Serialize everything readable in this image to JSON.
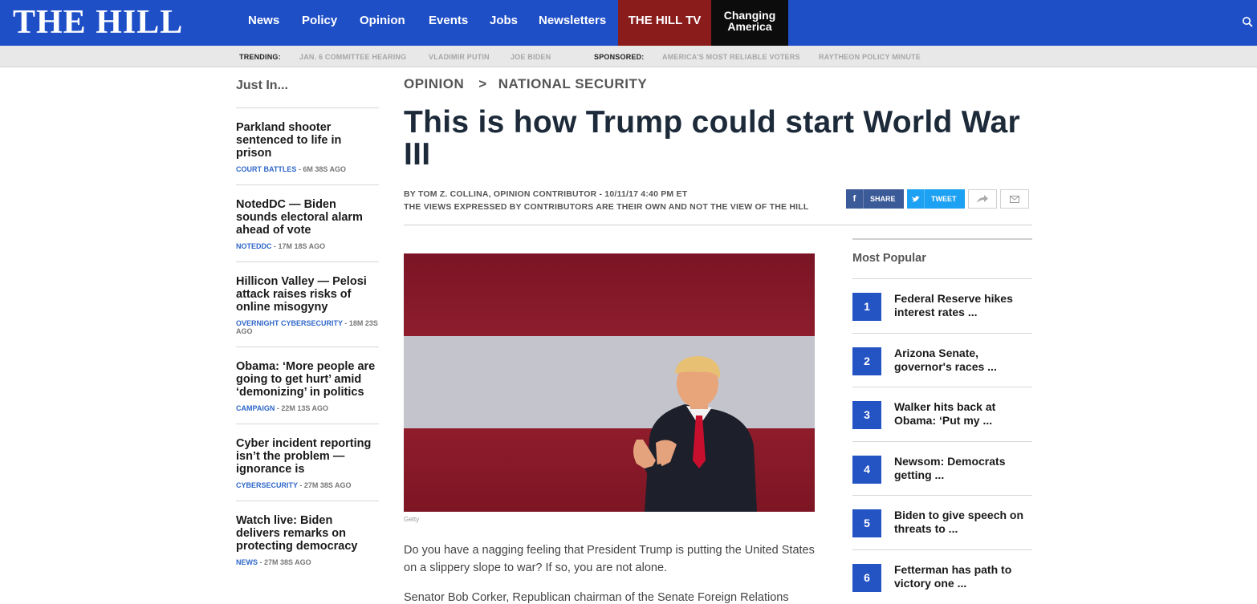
{
  "brand": {
    "logo": "THE HILL"
  },
  "nav": {
    "items": [
      "News",
      "Policy",
      "Opinion",
      "Events",
      "Jobs",
      "Newsletters"
    ],
    "tv": "THE HILL TV",
    "changing": "Changing\nAmerica"
  },
  "trending": {
    "label": "TRENDING:",
    "links": [
      "JAN. 6 COMMITTEE HEARING",
      "VLADIMIR PUTIN",
      "JOE BIDEN"
    ],
    "sponsored_label": "SPONSORED:",
    "sponsored_links": [
      "AMERICA'S MOST RELIABLE VOTERS",
      "RAYTHEON POLICY MINUTE"
    ]
  },
  "just_in": {
    "title": "Just In...",
    "items": [
      {
        "title": "Parkland shooter sentenced to life in prison",
        "category": "COURT BATTLES",
        "time": " - 6M 38S AGO"
      },
      {
        "title": "NotedDC — Biden sounds electoral alarm ahead of vote",
        "category": "NOTEDDC",
        "time": " - 17M 18S AGO"
      },
      {
        "title": "Hillicon Valley — Pelosi attack raises risks of online misogyny",
        "category": "OVERNIGHT CYBERSECURITY",
        "time": " - 18M 23S AGO"
      },
      {
        "title": "Obama: ‘More people are going to get hurt’ amid ‘demonizing’ in politics",
        "category": "CAMPAIGN",
        "time": " - 22M 13S AGO"
      },
      {
        "title": "Cyber incident reporting isn’t the problem — ignorance is",
        "category": "CYBERSECURITY",
        "time": " - 27M 38S AGO"
      },
      {
        "title": "Watch live: Biden delivers remarks on protecting democracy",
        "category": "NEWS",
        "time": " - 27M 38S AGO"
      }
    ]
  },
  "article": {
    "breadcrumb": [
      "OPINION",
      ">",
      "NATIONAL SECURITY"
    ],
    "headline": "This is how Trump could start World War III",
    "byline": "BY TOM Z. COLLINA, OPINION CONTRIBUTOR - 10/11/17 4:40 PM ET",
    "disclaimer": "THE VIEWS EXPRESSED BY CONTRIBUTORS ARE THEIR OWN AND NOT THE VIEW OF THE HILL",
    "share": {
      "facebook": "SHARE",
      "twitter": "TWEET"
    },
    "image_caption": "Getty",
    "paragraphs": [
      "Do you have a nagging feeling that President Trump is putting the United States on a slippery slope to war? If so, you are not alone.",
      "Senator Bob Corker, Republican chairman of the Senate Foreign Relations"
    ]
  },
  "most_popular": {
    "title": "Most Popular",
    "items": [
      {
        "rank": "1",
        "title": "Federal Reserve hikes interest rates ..."
      },
      {
        "rank": "2",
        "title": "Arizona Senate, governor's races ..."
      },
      {
        "rank": "3",
        "title": "Walker hits back at Obama: ‘Put my ..."
      },
      {
        "rank": "4",
        "title": "Newsom: Democrats getting ..."
      },
      {
        "rank": "5",
        "title": "Biden to give speech on threats to ..."
      },
      {
        "rank": "6",
        "title": "Fetterman has path to victory one ..."
      }
    ]
  },
  "colors": {
    "nav_blue": "#1f4fc7",
    "tv_red": "#8b1c1c",
    "accent_blue": "#2453c4"
  }
}
